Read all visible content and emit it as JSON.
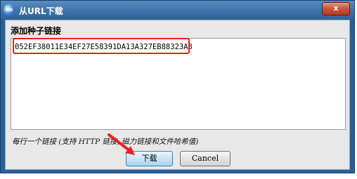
{
  "window": {
    "title": "从URL下载",
    "app_icon_text": "db",
    "close_label": "x"
  },
  "form": {
    "section_label": "添加种子链接",
    "url_value": "052EF38011E34EF27E58391DA13A327EB88323A3",
    "hint": "每行一个链接 (支持 HTTP 链接, 磁力链接和文件哈希值)"
  },
  "buttons": {
    "download_label": "下载",
    "cancel_label": "Cancel"
  },
  "colors": {
    "titlebar": "#3e73ab",
    "highlight_box": "#e8231f",
    "arrow": "#e8231f",
    "client_bg": "#e8e8e8"
  }
}
